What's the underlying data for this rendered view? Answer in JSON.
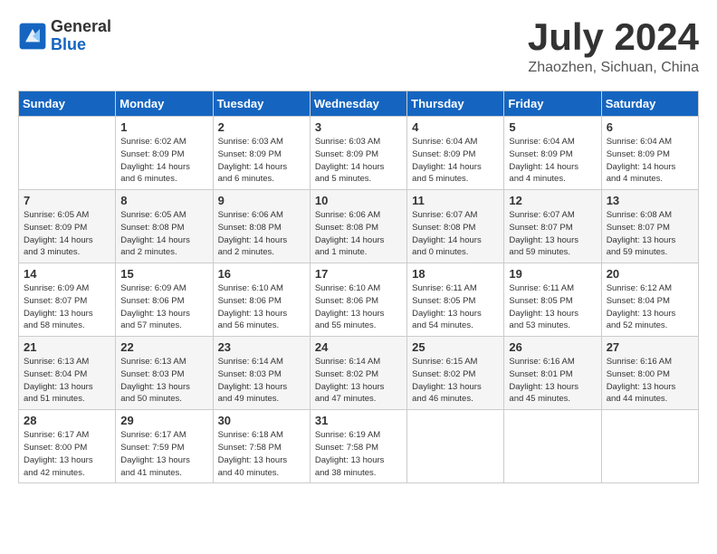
{
  "header": {
    "logo_general": "General",
    "logo_blue": "Blue",
    "title": "July 2024",
    "location": "Zhaozhen, Sichuan, China"
  },
  "days_of_week": [
    "Sunday",
    "Monday",
    "Tuesday",
    "Wednesday",
    "Thursday",
    "Friday",
    "Saturday"
  ],
  "weeks": [
    [
      {
        "day": "",
        "info": ""
      },
      {
        "day": "1",
        "info": "Sunrise: 6:02 AM\nSunset: 8:09 PM\nDaylight: 14 hours\nand 6 minutes."
      },
      {
        "day": "2",
        "info": "Sunrise: 6:03 AM\nSunset: 8:09 PM\nDaylight: 14 hours\nand 6 minutes."
      },
      {
        "day": "3",
        "info": "Sunrise: 6:03 AM\nSunset: 8:09 PM\nDaylight: 14 hours\nand 5 minutes."
      },
      {
        "day": "4",
        "info": "Sunrise: 6:04 AM\nSunset: 8:09 PM\nDaylight: 14 hours\nand 5 minutes."
      },
      {
        "day": "5",
        "info": "Sunrise: 6:04 AM\nSunset: 8:09 PM\nDaylight: 14 hours\nand 4 minutes."
      },
      {
        "day": "6",
        "info": "Sunrise: 6:04 AM\nSunset: 8:09 PM\nDaylight: 14 hours\nand 4 minutes."
      }
    ],
    [
      {
        "day": "7",
        "info": "Sunrise: 6:05 AM\nSunset: 8:09 PM\nDaylight: 14 hours\nand 3 minutes."
      },
      {
        "day": "8",
        "info": "Sunrise: 6:05 AM\nSunset: 8:08 PM\nDaylight: 14 hours\nand 2 minutes."
      },
      {
        "day": "9",
        "info": "Sunrise: 6:06 AM\nSunset: 8:08 PM\nDaylight: 14 hours\nand 2 minutes."
      },
      {
        "day": "10",
        "info": "Sunrise: 6:06 AM\nSunset: 8:08 PM\nDaylight: 14 hours\nand 1 minute."
      },
      {
        "day": "11",
        "info": "Sunrise: 6:07 AM\nSunset: 8:08 PM\nDaylight: 14 hours\nand 0 minutes."
      },
      {
        "day": "12",
        "info": "Sunrise: 6:07 AM\nSunset: 8:07 PM\nDaylight: 13 hours\nand 59 minutes."
      },
      {
        "day": "13",
        "info": "Sunrise: 6:08 AM\nSunset: 8:07 PM\nDaylight: 13 hours\nand 59 minutes."
      }
    ],
    [
      {
        "day": "14",
        "info": "Sunrise: 6:09 AM\nSunset: 8:07 PM\nDaylight: 13 hours\nand 58 minutes."
      },
      {
        "day": "15",
        "info": "Sunrise: 6:09 AM\nSunset: 8:06 PM\nDaylight: 13 hours\nand 57 minutes."
      },
      {
        "day": "16",
        "info": "Sunrise: 6:10 AM\nSunset: 8:06 PM\nDaylight: 13 hours\nand 56 minutes."
      },
      {
        "day": "17",
        "info": "Sunrise: 6:10 AM\nSunset: 8:06 PM\nDaylight: 13 hours\nand 55 minutes."
      },
      {
        "day": "18",
        "info": "Sunrise: 6:11 AM\nSunset: 8:05 PM\nDaylight: 13 hours\nand 54 minutes."
      },
      {
        "day": "19",
        "info": "Sunrise: 6:11 AM\nSunset: 8:05 PM\nDaylight: 13 hours\nand 53 minutes."
      },
      {
        "day": "20",
        "info": "Sunrise: 6:12 AM\nSunset: 8:04 PM\nDaylight: 13 hours\nand 52 minutes."
      }
    ],
    [
      {
        "day": "21",
        "info": "Sunrise: 6:13 AM\nSunset: 8:04 PM\nDaylight: 13 hours\nand 51 minutes."
      },
      {
        "day": "22",
        "info": "Sunrise: 6:13 AM\nSunset: 8:03 PM\nDaylight: 13 hours\nand 50 minutes."
      },
      {
        "day": "23",
        "info": "Sunrise: 6:14 AM\nSunset: 8:03 PM\nDaylight: 13 hours\nand 49 minutes."
      },
      {
        "day": "24",
        "info": "Sunrise: 6:14 AM\nSunset: 8:02 PM\nDaylight: 13 hours\nand 47 minutes."
      },
      {
        "day": "25",
        "info": "Sunrise: 6:15 AM\nSunset: 8:02 PM\nDaylight: 13 hours\nand 46 minutes."
      },
      {
        "day": "26",
        "info": "Sunrise: 6:16 AM\nSunset: 8:01 PM\nDaylight: 13 hours\nand 45 minutes."
      },
      {
        "day": "27",
        "info": "Sunrise: 6:16 AM\nSunset: 8:00 PM\nDaylight: 13 hours\nand 44 minutes."
      }
    ],
    [
      {
        "day": "28",
        "info": "Sunrise: 6:17 AM\nSunset: 8:00 PM\nDaylight: 13 hours\nand 42 minutes."
      },
      {
        "day": "29",
        "info": "Sunrise: 6:17 AM\nSunset: 7:59 PM\nDaylight: 13 hours\nand 41 minutes."
      },
      {
        "day": "30",
        "info": "Sunrise: 6:18 AM\nSunset: 7:58 PM\nDaylight: 13 hours\nand 40 minutes."
      },
      {
        "day": "31",
        "info": "Sunrise: 6:19 AM\nSunset: 7:58 PM\nDaylight: 13 hours\nand 38 minutes."
      },
      {
        "day": "",
        "info": ""
      },
      {
        "day": "",
        "info": ""
      },
      {
        "day": "",
        "info": ""
      }
    ]
  ]
}
